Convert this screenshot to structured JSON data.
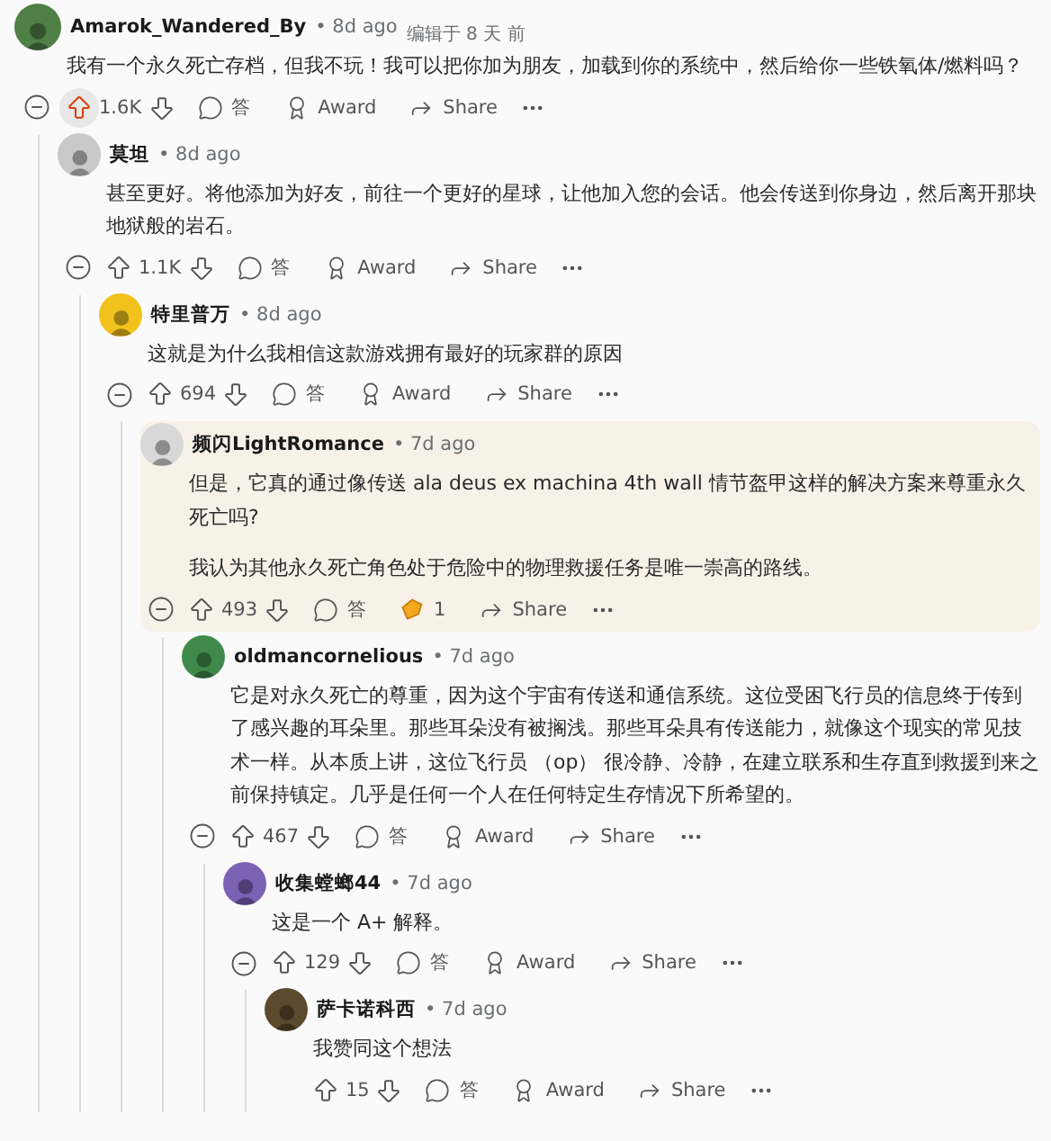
{
  "comments": [
    {
      "author": "Amarok_Wandered_By",
      "time": "• 8d ago",
      "edited": "编辑于 8 天 前",
      "color": "#4f7f45",
      "collapsible": true,
      "body": [
        "我有一个永久死亡存档，但我不玩！我可以把你加为朋友，加载到你的系统中，然后给你一些铁氧体/燃料吗？"
      ],
      "votes": "1.6K",
      "upvoted": true,
      "reply": "答",
      "award": {
        "kind": "button",
        "label": "Award"
      },
      "share": "Share",
      "children": [
        {
          "author": "莫坦",
          "time": "• 8d ago",
          "color": "#c9c9c9",
          "collapsible": true,
          "body": [
            "甚至更好。将他添加为好友，前往一个更好的星球，让他加入您的会话。他会传送到你身边，然后离开那块地狱般的岩石。"
          ],
          "votes": "1.1K",
          "upvoted": false,
          "reply": "答",
          "award": {
            "kind": "button",
            "label": "Award"
          },
          "share": "Share",
          "children": [
            {
              "author": "特里普万",
              "time": "• 8d ago",
              "color": "#f2c21c",
              "collapsible": true,
              "body": [
                "这就是为什么我相信这款游戏拥有最好的玩家群的原因"
              ],
              "votes": "694",
              "upvoted": false,
              "reply": "答",
              "award": {
                "kind": "button",
                "label": "Award"
              },
              "share": "Share",
              "children": [
                {
                  "author": "频闪LightRomance",
                  "time": "• 7d ago",
                  "color": "#d8d8d8",
                  "highlighted": true,
                  "collapsible": true,
                  "body": [
                    "但是，它真的通过像传送 ala deus ex machina 4th wall 情节盔甲这样的解决方案来尊重永久死亡吗?",
                    "我认为其他永久死亡角色处于危险中的物理救援任务是唯一崇高的路线。"
                  ],
                  "votes": "493",
                  "upvoted": false,
                  "reply": "答",
                  "award": {
                    "kind": "given",
                    "label": "1"
                  },
                  "share": "Share",
                  "children": [
                    {
                      "author": "oldmancornelious",
                      "time": "• 7d ago",
                      "color": "#3f8a4a",
                      "collapsible": true,
                      "body": [
                        "它是对永久死亡的尊重，因为这个宇宙有传送和通信系统。这位受困飞行员的信息终于传到了感兴趣的耳朵里。那些耳朵没有被搁浅。那些耳朵具有传送能力，就像这个现实的常见技术一样。从本质上讲，这位飞行员 （op） 很冷静、冷静，在建立联系和生存直到救援到来之前保持镇定。几乎是任何一个人在任何特定生存情况下所希望的。"
                      ],
                      "votes": "467",
                      "upvoted": false,
                      "reply": "答",
                      "award": {
                        "kind": "button",
                        "label": "Award"
                      },
                      "share": "Share",
                      "children": [
                        {
                          "author": "收集螳螂44",
                          "time": "• 7d ago",
                          "color": "#7b62b5",
                          "collapsible": true,
                          "body": [
                            "这是一个 A+ 解释。"
                          ],
                          "votes": "129",
                          "upvoted": false,
                          "reply": "答",
                          "award": {
                            "kind": "button",
                            "label": "Award"
                          },
                          "share": "Share",
                          "children": [
                            {
                              "author": "萨卡诺科西",
                              "time": "• 7d ago",
                              "color": "#5b4a2e",
                              "collapsible": false,
                              "body": [
                                "我赞同这个想法"
                              ],
                              "votes": "15",
                              "upvoted": false,
                              "reply": "答",
                              "award": {
                                "kind": "button",
                                "label": "Award"
                              },
                              "share": "Share"
                            }
                          ]
                        }
                      ]
                    }
                  ]
                }
              ]
            }
          ]
        }
      ]
    }
  ]
}
